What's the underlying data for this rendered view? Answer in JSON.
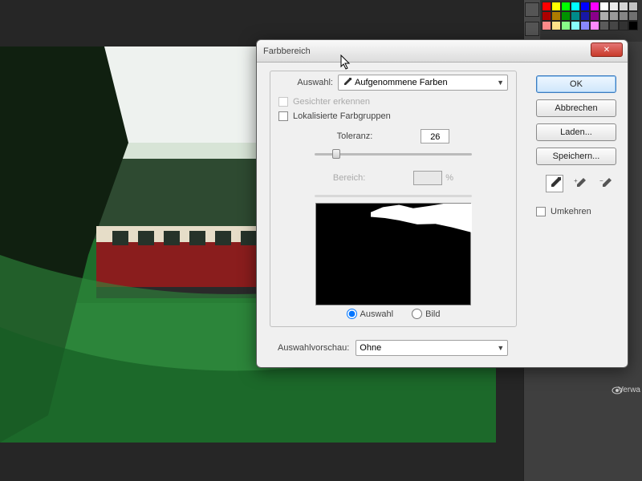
{
  "dialog": {
    "title": "Farbbereich",
    "selection_label": "Auswahl:",
    "selection_value": "Aufgenommene Farben",
    "detect_faces_label": "Gesichter erkennen",
    "localized_groups_label": "Lokalisierte Farbgruppen",
    "tolerance_label": "Toleranz:",
    "tolerance_value": "26",
    "range_label": "Bereich:",
    "range_unit": "%",
    "radio_selection": "Auswahl",
    "radio_image": "Bild",
    "preview_label": "Auswahlvorschau:",
    "preview_value": "Ohne"
  },
  "buttons": {
    "ok": "OK",
    "cancel": "Abbrechen",
    "load": "Laden...",
    "save": "Speichern...",
    "invert": "Umkehren"
  },
  "right_panel": {
    "layer_hint": "Verwa"
  },
  "swatches": [
    [
      "#ff0000",
      "#ffff00",
      "#00ff00",
      "#00ffff",
      "#0000ff",
      "#ff00ff",
      "#ffffff",
      "#ebebeb",
      "#d6d6d6",
      "#c2c2c2"
    ],
    [
      "#ad0000",
      "#ad7b00",
      "#009200",
      "#008a8a",
      "#1818a5",
      "#8a008a",
      "#adadad",
      "#999999",
      "#858585",
      "#707070"
    ],
    [
      "#ff8a8a",
      "#ffe38a",
      "#8aff8a",
      "#8affff",
      "#8a8aff",
      "#ff8aff",
      "#5c5c5c",
      "#474747",
      "#333333",
      "#000000"
    ]
  ]
}
